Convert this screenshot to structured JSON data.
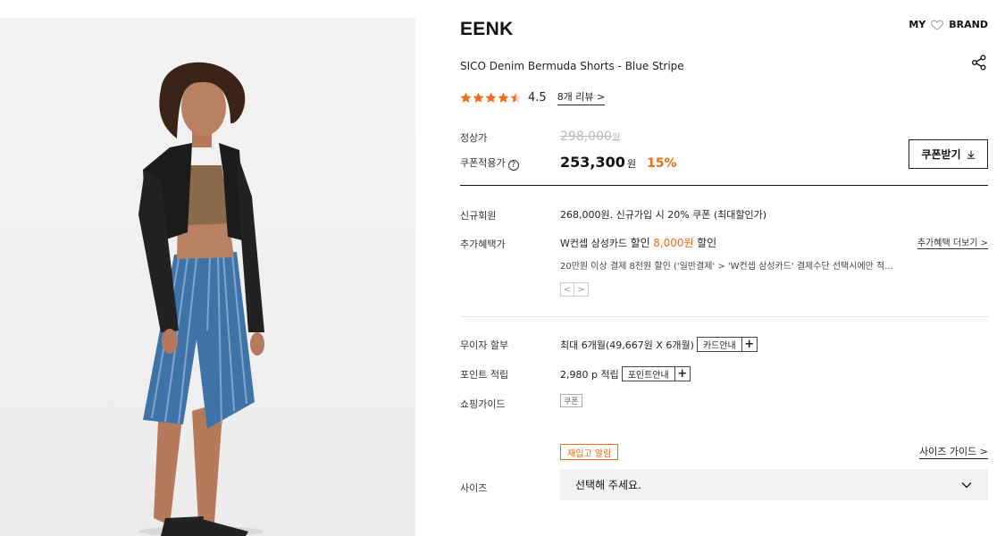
{
  "brand": "EENK",
  "top_links": {
    "my": "MY",
    "brand": "BRAND"
  },
  "product_name": "SICO Denim Bermuda Shorts - Blue Stripe",
  "rating": {
    "value": "4.5",
    "score": 4.5,
    "max": 5,
    "review_link": "8개 리뷰 >",
    "star_color": "#ef6c1a"
  },
  "price": {
    "regular_label": "정상가",
    "regular_value": "298,000",
    "regular_won": "원",
    "coupon_label": "쿠폰적용가",
    "coupon_value": "253,300",
    "coupon_won": "원",
    "discount": "15%",
    "coupon_button": "쿠폰받기"
  },
  "benefits": {
    "new_member_label": "신규회원",
    "new_member_value": "268,000원. 신규가입 시 20% 쿠폰 (최대할인가)",
    "extra_label": "추가혜택가",
    "extra_card": "W컨셉 삼성카드",
    "extra_discount_word": "할인",
    "extra_amount": "8,000원",
    "extra_suffix": "할인",
    "extra_more": "추가혜택 더보기 >",
    "extra_note": "20만원 이상 결제 8천원 할인 ('일반결제' > 'W컨셉 삼성카드' 결제수단 선택시에만 적...",
    "pager_prev": "<",
    "pager_next": ">"
  },
  "installment": {
    "label": "무이자 할부",
    "value": "최대 6개월(49,667원 X 6개월)",
    "button": "카드안내",
    "plus": "+"
  },
  "points": {
    "label": "포인트 적립",
    "value": "2,980 p 적립",
    "button": "포인트안내",
    "plus": "+"
  },
  "shopping_guide": {
    "label": "쇼핑가이드",
    "tag": "쿠폰"
  },
  "size": {
    "restock": "재입고 알림",
    "guide": "사이즈 가이드 >",
    "label": "사이즈",
    "placeholder": "선택해 주세요."
  },
  "colors": {
    "accent": "#ef6c1a",
    "text": "#111111",
    "select_bg": "#f2f2f2"
  }
}
